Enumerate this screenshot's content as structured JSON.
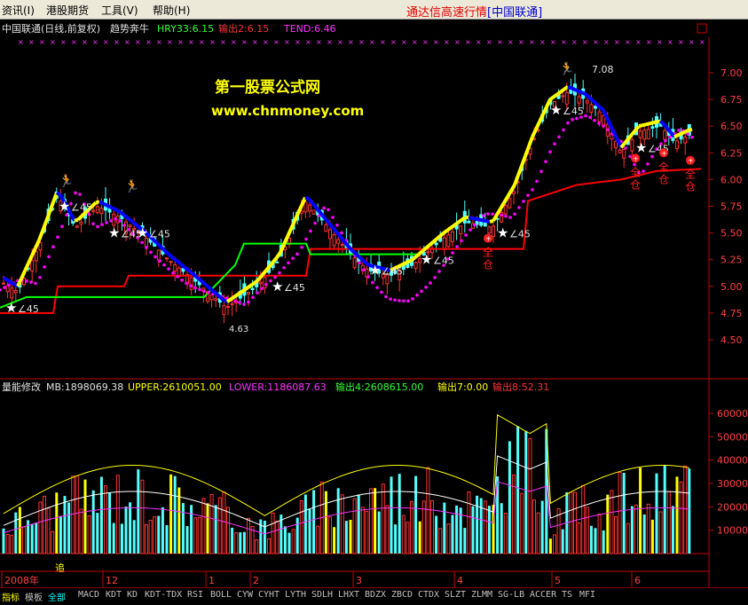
{
  "menu": {
    "items": [
      "资讯(I)",
      "港股期货",
      "工具(V)",
      "帮助(H)"
    ],
    "brand": "通达信高速行情",
    "brand_bracket": "[中国联通]"
  },
  "header": {
    "title": "中国联通(日线,前复权)",
    "indicator": "趋势奔牛",
    "hry": "HRY33:6.15",
    "out2": "输出2:6.15",
    "tend": "TEND:6.46"
  },
  "watermark": {
    "line1": "第一股票公式网",
    "line2": "www.chnmoney.com"
  },
  "price_axis": {
    "labels": [
      "7.00",
      "6.75",
      "6.50",
      "6.25",
      "6.00",
      "5.75",
      "5.50",
      "5.25",
      "5.00",
      "4.75",
      "4.50"
    ],
    "min": 4.5,
    "max": 7.0
  },
  "price_annotations": {
    "high": "7.08",
    "low": "4.63",
    "angle": "∠45",
    "full_pos_chars": [
      "全",
      "仓"
    ]
  },
  "vol_header": {
    "name": "量能修改",
    "mb": "MB:1898069.38",
    "upper": "UPPER:2610051.00",
    "lower": "LOWER:1186087.63",
    "out4": "输出4:2608615.00",
    "out7": "输出7:0.00",
    "out8": "输出8:52.31"
  },
  "vol_axis": {
    "labels": [
      "60000",
      "50000",
      "40000",
      "30000",
      "20000",
      "10000"
    ],
    "min": 0,
    "max": 60000
  },
  "vol_note": "追",
  "time_axis": {
    "labels": [
      "2008年",
      "12",
      "1",
      "2",
      "3",
      "4",
      "5",
      "6"
    ]
  },
  "tabs": [
    "指标",
    "模板",
    "全部",
    "MACD",
    "KDT",
    "KD",
    "KDT-TDX",
    "RSI",
    "BOLL",
    "CYW",
    "CYHT",
    "LYTH",
    "SDLH",
    "LHXT",
    "BDZX",
    "ZBCD",
    "CTDX",
    "SLZT",
    "ZLMM",
    "SG-LB",
    "ACCER",
    "TS",
    "MFI"
  ],
  "colors": {
    "up_candle": "#ff3333",
    "down_candle": "#54ffff",
    "trend_up": "#ffff00",
    "trend_down": "#0000ff",
    "dots": "#ff00ff",
    "support": "#ff0000",
    "support2": "#00ff00",
    "brand": "#e00000"
  }
}
